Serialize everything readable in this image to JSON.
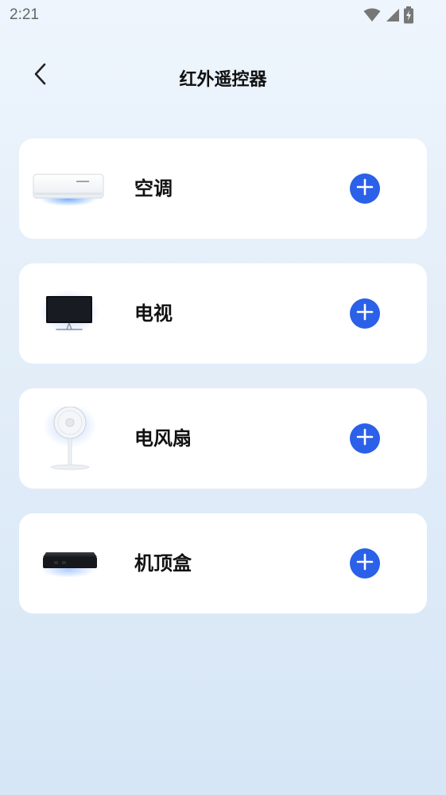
{
  "status_bar": {
    "time": "2:21",
    "icons": [
      "wifi-icon",
      "signal-icon",
      "battery-charging-icon"
    ]
  },
  "header": {
    "title": "红外遥控器",
    "back_icon": "chevron-left-icon"
  },
  "devices": [
    {
      "label": "空调",
      "image": "air-conditioner",
      "action_icon": "plus-circle-icon"
    },
    {
      "label": "电视",
      "image": "television",
      "action_icon": "plus-circle-icon"
    },
    {
      "label": "电风扇",
      "image": "electric-fan",
      "action_icon": "plus-circle-icon"
    },
    {
      "label": "机顶盒",
      "image": "set-top-box",
      "action_icon": "plus-circle-icon"
    }
  ],
  "colors": {
    "accent": "#2b60e8",
    "card": "#ffffff",
    "background_top": "#eef5fd",
    "background_bottom": "#d6e6f6"
  }
}
